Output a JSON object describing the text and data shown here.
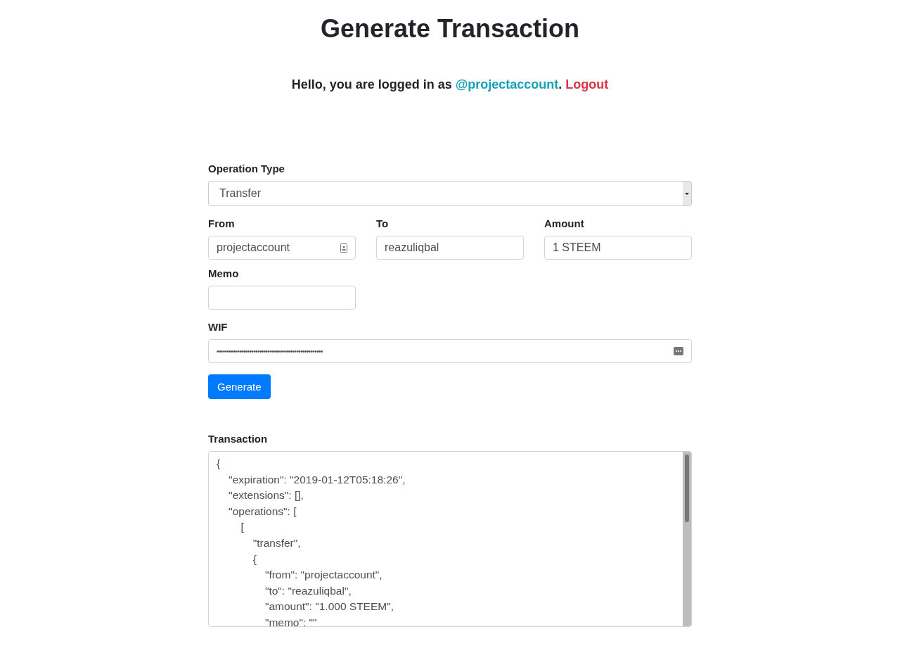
{
  "title": "Generate Transaction",
  "greeting": {
    "prefix": "Hello, you are logged in as",
    "account": "@projectaccount",
    "separator": ".",
    "logout": "Logout"
  },
  "operation_type": {
    "label": "Operation Type",
    "value": "Transfer"
  },
  "fields": [
    {
      "label": "From",
      "value": "projectaccount",
      "kind": "contact"
    },
    {
      "label": "To",
      "value": "reazuliqbal",
      "kind": "text"
    },
    {
      "label": "Amount",
      "value": "1 STEEM",
      "kind": "text"
    },
    {
      "label": "Memo",
      "kind": "text"
    }
  ],
  "wif": {
    "label": "WIF",
    "value": "••••••••••••••••••••••••••••••••••••••••••••••••••••"
  },
  "generate_button": "Generate",
  "transaction": {
    "label": "Transaction",
    "value": "{\n    \"expiration\": \"2019-01-12T05:18:26\",\n    \"extensions\": [],\n    \"operations\": [\n        [\n            \"transfer\",\n            {\n                \"from\": \"projectaccount\",\n                \"to\": \"reazuliqbal\",\n                \"amount\": \"1.000 STEEM\",\n                \"memo\": \"\""
  }
}
